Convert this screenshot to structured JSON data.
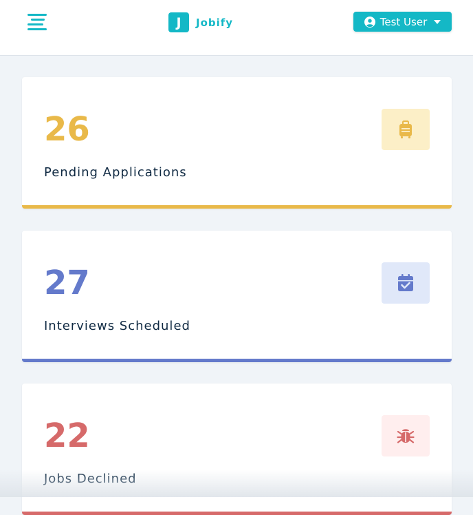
{
  "navbar": {
    "logo_letter": "J",
    "logo_text": "Jobify",
    "user_name": "Test User",
    "accent_color": "#14b8c6"
  },
  "stats": [
    {
      "count": "26",
      "title": "Pending Applications",
      "icon": "suitcase-icon",
      "color": "#e9b949",
      "bg": "#fcefc7"
    },
    {
      "count": "27",
      "title": "Interviews Scheduled",
      "icon": "calendar-check-icon",
      "color": "#647acb",
      "bg": "#e0e8f9"
    },
    {
      "count": "22",
      "title": "Jobs Declined",
      "icon": "bug-icon",
      "color": "#d66a6a",
      "bg": "#ffeeee"
    }
  ]
}
